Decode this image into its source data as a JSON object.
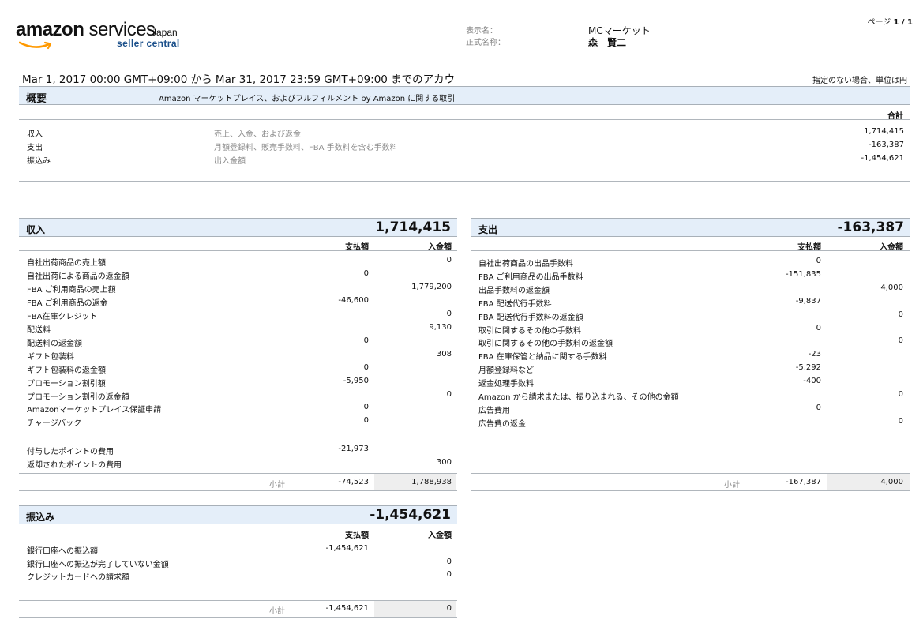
{
  "logo": {
    "brand_bold": "amazon",
    "brand_rest": " services",
    "region": "Japan",
    "product": "seller central"
  },
  "header": {
    "display_name_label": "表示名：",
    "legal_name_label": "正式名称：",
    "display_name": "MCマーケット",
    "legal_name": "森　賢二",
    "page_prefix": "ページ ",
    "page_value": "1 / 1"
  },
  "period": "Mar 1, 2017 00:00 GMT+09:00 から Mar 31, 2017 23:59 GMT+09:00 までのアカウ",
  "unit_note": "指定のない場合、単位は円",
  "summary": {
    "title": "概要",
    "subtitle": "Amazon マーケットプレイス、およびフルフィルメント by Amazon に関する取引",
    "total_header": "合計",
    "rows": [
      {
        "label": "収入",
        "desc": "売上、入金、および返金",
        "value": "1,714,415"
      },
      {
        "label": "支出",
        "desc": "月額登録料、販売手数料、FBA 手数料を含む手数料",
        "value": "-163,387"
      },
      {
        "label": "振込み",
        "desc": "出入金額",
        "value": "-1,454,621"
      }
    ]
  },
  "income": {
    "title": "収入",
    "total": "1,714,415",
    "col_pay": "支払額",
    "col_rcv": "入金額",
    "rows": [
      {
        "label": "自社出荷商品の売上額",
        "pay": "",
        "rcv": "0"
      },
      {
        "label": "自社出荷による商品の返金額",
        "pay": "0",
        "rcv": ""
      },
      {
        "label": "FBA ご利用商品の売上額",
        "pay": "",
        "rcv": "1,779,200"
      },
      {
        "label": "FBA ご利用商品の返金",
        "pay": "-46,600",
        "rcv": ""
      },
      {
        "label": "FBA在庫クレジット",
        "pay": "",
        "rcv": "0"
      },
      {
        "label": "配送料",
        "pay": "",
        "rcv": "9,130"
      },
      {
        "label": "配送料の返金額",
        "pay": "0",
        "rcv": ""
      },
      {
        "label": "ギフト包装料",
        "pay": "",
        "rcv": "308"
      },
      {
        "label": "ギフト包装料の返金額",
        "pay": "0",
        "rcv": ""
      },
      {
        "label": "プロモーション割引額",
        "pay": "-5,950",
        "rcv": ""
      },
      {
        "label": "プロモーション割引の返金額",
        "pay": "",
        "rcv": "0"
      },
      {
        "label": "Amazonマーケットプレイス保証申請",
        "pay": "0",
        "rcv": ""
      },
      {
        "label": "チャージバック",
        "pay": "0",
        "rcv": ""
      }
    ],
    "points": [
      {
        "label": "付与したポイントの費用",
        "pay": "-21,973",
        "rcv": ""
      },
      {
        "label": "返却されたポイントの費用",
        "pay": "",
        "rcv": "300"
      }
    ],
    "subtotal_label": "小計",
    "subtotal_pay": "-74,523",
    "subtotal_rcv": "1,788,938"
  },
  "expense": {
    "title": "支出",
    "total": "-163,387",
    "col_pay": "支払額",
    "col_rcv": "入金額",
    "rows": [
      {
        "label": "自社出荷商品の出品手数料",
        "pay": "0",
        "rcv": ""
      },
      {
        "label": "FBA ご利用商品の出品手数料",
        "pay": "-151,835",
        "rcv": ""
      },
      {
        "label": "出品手数料の返金額",
        "pay": "",
        "rcv": "4,000"
      },
      {
        "label": "FBA 配送代行手数料",
        "pay": "-9,837",
        "rcv": ""
      },
      {
        "label": "FBA 配送代行手数料の返金額",
        "pay": "",
        "rcv": "0"
      },
      {
        "label": "取引に関するその他の手数料",
        "pay": "0",
        "rcv": ""
      },
      {
        "label": "取引に関するその他の手数料の返金額",
        "pay": "",
        "rcv": "0"
      },
      {
        "label": "FBA 在庫保管と納品に関する手数料",
        "pay": "-23",
        "rcv": ""
      },
      {
        "label": "月額登録料など",
        "pay": "-5,292",
        "rcv": ""
      },
      {
        "label": "返金処理手数料",
        "pay": "-400",
        "rcv": ""
      },
      {
        "label": "Amazon から請求または、振り込まれる、その他の金額",
        "pay": "",
        "rcv": "0"
      },
      {
        "label": "広告費用",
        "pay": "0",
        "rcv": ""
      },
      {
        "label": "広告費の返金",
        "pay": "",
        "rcv": "0"
      }
    ],
    "subtotal_label": "小計",
    "subtotal_pay": "-167,387",
    "subtotal_rcv": "4,000"
  },
  "transfer": {
    "title": "振込み",
    "total": "-1,454,621",
    "col_pay": "支払額",
    "col_rcv": "入金額",
    "rows": [
      {
        "label": "銀行口座への振込額",
        "pay": "-1,454,621",
        "rcv": ""
      },
      {
        "label": "銀行口座への振込が完了していない金額",
        "pay": "",
        "rcv": "0"
      },
      {
        "label": "クレジットカードへの請求額",
        "pay": "",
        "rcv": "0"
      }
    ],
    "subtotal_label": "小計",
    "subtotal_pay": "-1,454,621",
    "subtotal_rcv": "0"
  },
  "colors": {
    "band": "#e4eef9",
    "logo_orange": "#f90",
    "logo_blue": "#1a4f8a"
  }
}
